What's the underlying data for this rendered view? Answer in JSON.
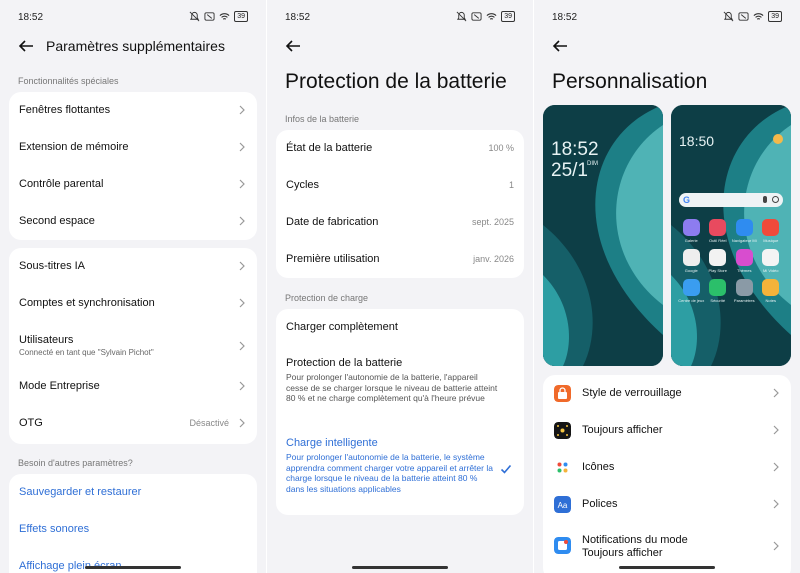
{
  "colors": {
    "accent": "#2f6fd6",
    "background": "#f3f3f6",
    "card": "#ffffff"
  },
  "panel1": {
    "status": {
      "time": "18:52",
      "battery": "39"
    },
    "title": "Paramètres supplémentaires",
    "section_special": "Fonctionnalités spéciales",
    "group1": [
      {
        "label": "Fenêtres flottantes"
      },
      {
        "label": "Extension de mémoire"
      },
      {
        "label": "Contrôle parental"
      },
      {
        "label": "Second espace"
      }
    ],
    "group2": [
      {
        "label": "Sous-titres IA"
      },
      {
        "label": "Comptes et synchronisation"
      },
      {
        "label": "Utilisateurs",
        "sub": "Connecté en tant que \"Sylvain Pichot\""
      },
      {
        "label": "Mode Entreprise"
      },
      {
        "label": "OTG",
        "value": "Désactivé"
      }
    ],
    "section_more": "Besoin d'autres paramètres?",
    "links": [
      {
        "label": "Sauvegarder et restaurer"
      },
      {
        "label": "Effets sonores"
      },
      {
        "label": "Affichage plein écran"
      }
    ]
  },
  "panel2": {
    "status": {
      "time": "18:52",
      "battery": "39"
    },
    "title": "Protection de la batterie",
    "section_info": "Infos de la batterie",
    "info": [
      {
        "label": "État de la batterie",
        "value": "100 %"
      },
      {
        "label": "Cycles",
        "value": "1"
      },
      {
        "label": "Date de fabrication",
        "value": "sept. 2025"
      },
      {
        "label": "Première utilisation",
        "value": "janv. 2026"
      }
    ],
    "section_charge": "Protection de charge",
    "charge": {
      "full": "Charger complètement",
      "protect_label": "Protection de la batterie",
      "protect_desc": "Pour prolonger l'autonomie de la batterie, l'appareil cesse de se charger lorsque le niveau de batterie atteint 80 % et ne charge complètement qu'à l'heure prévue",
      "smart_label": "Charge intelligente",
      "smart_desc": "Pour prolonger l'autonomie de la batterie, le système apprendra comment charger votre appareil et arrêter la charge lorsque le niveau de la batterie atteint 80 % dans les situations applicables"
    }
  },
  "panel3": {
    "status": {
      "time": "18:52",
      "battery": "39"
    },
    "title": "Personnalisation",
    "lock_preview": {
      "time": "18:52",
      "date": "25/1",
      "day": "DIM"
    },
    "home_preview": {
      "time": "18:50"
    },
    "apps": [
      {
        "name": "Galerie",
        "color": "#8d7cf0"
      },
      {
        "name": "Outil Réel",
        "color": "#e84a5f"
      },
      {
        "name": "Navigateur Mi",
        "color": "#2f8cf0"
      },
      {
        "name": "Musique",
        "color": "#f04a3a"
      },
      {
        "name": "Google",
        "color": "#eeeeee"
      },
      {
        "name": "Play Store",
        "color": "#f2f2f2"
      },
      {
        "name": "Thèmes",
        "color": "#d84dcf"
      },
      {
        "name": "Mi Vidéo",
        "color": "#f4f4f4"
      },
      {
        "name": "Centre de jeux",
        "color": "#3a9df0"
      },
      {
        "name": "Sécurité",
        "color": "#2bbf6a"
      },
      {
        "name": "Paramètres",
        "color": "#8a9aa6"
      },
      {
        "name": "Notes",
        "color": "#f4b33a"
      }
    ],
    "items": [
      {
        "label": "Style de verrouillage",
        "icon_color": "#f06a2a"
      },
      {
        "label": "Toujours afficher",
        "icon_color": "#151515"
      },
      {
        "label": "Icônes",
        "icon_color": "#ffffff"
      },
      {
        "label": "Polices",
        "icon_color": "#2f6fd6",
        "icon_text": "Aa"
      },
      {
        "label": "Notifications du mode\nToujours afficher",
        "icon_color": "#2f8cf0"
      }
    ]
  }
}
